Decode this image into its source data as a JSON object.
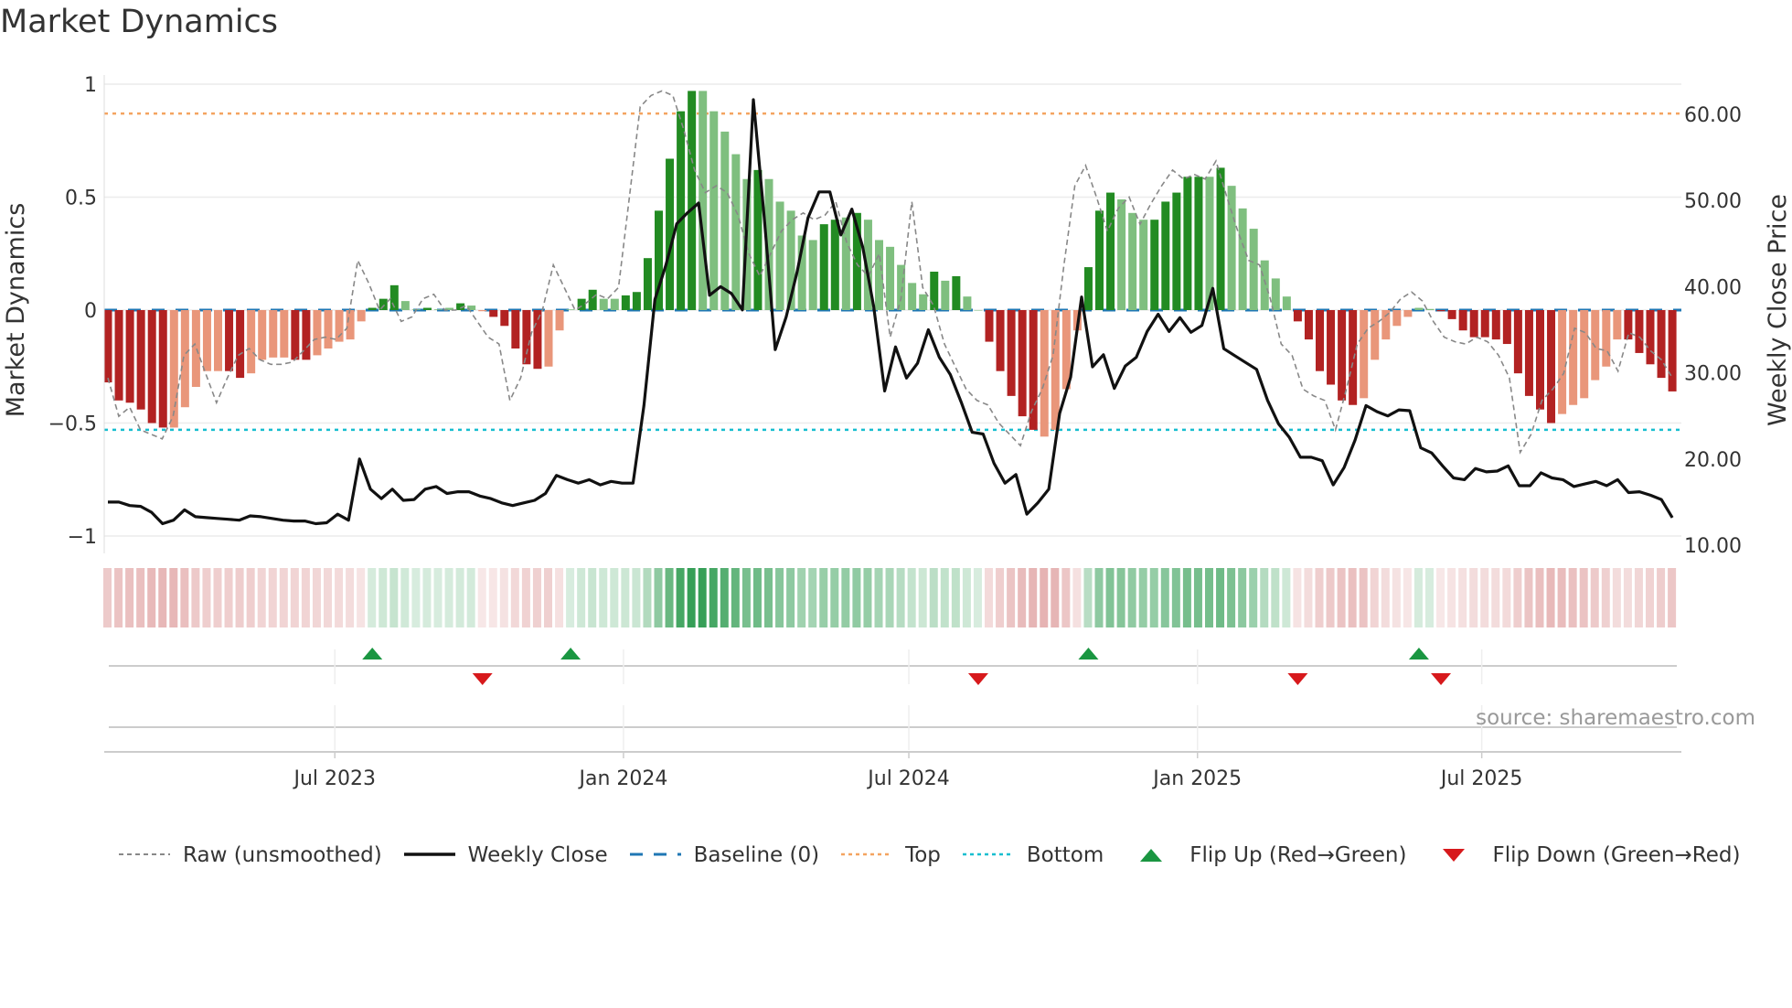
{
  "chart_data": {
    "type": "bar",
    "title": "Market Dynamics",
    "ylabel": "Market Dynamics",
    "y2label": "Weekly Close Price",
    "ylim": [
      -1.08,
      1.04
    ],
    "y2lim": [
      8.9,
      63.4
    ],
    "yticks": [
      {
        "v": 1,
        "label": "1"
      },
      {
        "v": 0.5,
        "label": "0.5"
      },
      {
        "v": 0,
        "label": "0"
      },
      {
        "v": -0.5,
        "label": "−0.5"
      },
      {
        "v": -1,
        "label": "−1"
      }
    ],
    "y2ticks": [
      {
        "v": 60,
        "label": "60.00"
      },
      {
        "v": 50,
        "label": "50.00"
      },
      {
        "v": 40,
        "label": "40.00"
      },
      {
        "v": 30,
        "label": "30.00"
      },
      {
        "v": 20,
        "label": "20.00"
      },
      {
        "v": 10,
        "label": "10.00"
      }
    ],
    "xticks": [
      {
        "week": 20.6,
        "label": "Jul 2023"
      },
      {
        "week": 46.8,
        "label": "Jan 2024"
      },
      {
        "week": 72.7,
        "label": "Jul 2024"
      },
      {
        "week": 98.9,
        "label": "Jan 2025"
      },
      {
        "week": 124.7,
        "label": "Jul 2025"
      }
    ],
    "top_level": 0.87,
    "bottom_level": -0.53,
    "baseline": 0,
    "dynamics": [
      -0.32,
      -0.4,
      -0.41,
      -0.44,
      -0.5,
      -0.52,
      -0.52,
      -0.43,
      -0.34,
      -0.27,
      -0.27,
      -0.27,
      -0.3,
      -0.28,
      -0.22,
      -0.21,
      -0.21,
      -0.22,
      -0.22,
      -0.2,
      -0.17,
      -0.14,
      -0.13,
      -0.05,
      0.01,
      0.05,
      0.11,
      0.04,
      0.003,
      0.01,
      0.003,
      0.01,
      0.03,
      0.02,
      -0.005,
      -0.03,
      -0.07,
      -0.17,
      -0.24,
      -0.26,
      -0.25,
      -0.09,
      0.003,
      0.05,
      0.09,
      0.05,
      0.05,
      0.065,
      0.08,
      0.23,
      0.44,
      0.67,
      0.88,
      0.97,
      0.97,
      0.88,
      0.79,
      0.69,
      0.58,
      0.62,
      0.58,
      0.48,
      0.44,
      0.33,
      0.31,
      0.38,
      0.4,
      0.41,
      0.43,
      0.4,
      0.31,
      0.28,
      0.2,
      0.12,
      0.07,
      0.17,
      0.13,
      0.15,
      0.06,
      0.0,
      -0.14,
      -0.27,
      -0.38,
      -0.47,
      -0.53,
      -0.56,
      -0.53,
      -0.35,
      -0.09,
      0.19,
      0.44,
      0.52,
      0.49,
      0.43,
      0.4,
      0.4,
      0.48,
      0.52,
      0.59,
      0.59,
      0.59,
      0.63,
      0.55,
      0.45,
      0.36,
      0.22,
      0.14,
      0.06,
      -0.05,
      -0.13,
      -0.27,
      -0.33,
      -0.4,
      -0.42,
      -0.39,
      -0.22,
      -0.13,
      -0.07,
      -0.03,
      0.01,
      0.005,
      -0.005,
      -0.04,
      -0.09,
      -0.12,
      -0.12,
      -0.13,
      -0.15,
      -0.28,
      -0.38,
      -0.44,
      -0.5,
      -0.46,
      -0.42,
      -0.39,
      -0.31,
      -0.25,
      -0.13,
      -0.13,
      -0.19,
      -0.24,
      -0.3,
      -0.36
    ],
    "strong": [
      1,
      1,
      1,
      1,
      1,
      1,
      0,
      0,
      0,
      0,
      0,
      1,
      1,
      0,
      0,
      0,
      0,
      1,
      1,
      0,
      0,
      0,
      0,
      0,
      1,
      1,
      1,
      0,
      0,
      1,
      0,
      0,
      1,
      0,
      0,
      1,
      1,
      1,
      1,
      1,
      0,
      0,
      0,
      1,
      1,
      0,
      0,
      1,
      1,
      1,
      1,
      1,
      1,
      1,
      0,
      0,
      0,
      0,
      0,
      1,
      0,
      0,
      0,
      0,
      0,
      1,
      1,
      0,
      1,
      0,
      0,
      0,
      0,
      0,
      0,
      1,
      0,
      1,
      0,
      0,
      1,
      1,
      1,
      1,
      1,
      0,
      0,
      0,
      0,
      1,
      1,
      1,
      0,
      0,
      0,
      1,
      1,
      1,
      1,
      1,
      0,
      1,
      0,
      0,
      0,
      0,
      0,
      0,
      1,
      1,
      1,
      1,
      1,
      1,
      0,
      0,
      0,
      0,
      0,
      0,
      0,
      1,
      1,
      1,
      1,
      1,
      1,
      1,
      1,
      1,
      1,
      1,
      0,
      0,
      0,
      0,
      0,
      0,
      1,
      1,
      1,
      1,
      1
    ],
    "raw": [
      -0.3,
      -0.47,
      -0.43,
      -0.53,
      -0.55,
      -0.57,
      -0.47,
      -0.2,
      -0.15,
      -0.28,
      -0.41,
      -0.3,
      -0.2,
      -0.17,
      -0.22,
      -0.24,
      -0.24,
      -0.23,
      -0.18,
      -0.13,
      -0.12,
      -0.13,
      -0.08,
      0.22,
      0.12,
      0.0,
      0.05,
      -0.05,
      -0.03,
      0.05,
      0.07,
      0.0,
      0.0,
      0.02,
      -0.05,
      -0.12,
      -0.15,
      -0.4,
      -0.3,
      -0.1,
      0.0,
      0.2,
      0.1,
      0.0,
      0.03,
      0.07,
      0.05,
      0.1,
      0.5,
      0.9,
      0.95,
      0.97,
      0.95,
      0.8,
      0.62,
      0.52,
      0.55,
      0.52,
      0.42,
      0.25,
      0.15,
      0.25,
      0.35,
      0.4,
      0.43,
      0.4,
      0.42,
      0.48,
      0.3,
      0.2,
      0.15,
      0.25,
      -0.12,
      0.05,
      0.48,
      0.1,
      0.02,
      -0.15,
      -0.25,
      -0.35,
      -0.4,
      -0.42,
      -0.5,
      -0.55,
      -0.6,
      -0.45,
      -0.35,
      -0.2,
      0.2,
      0.55,
      0.64,
      0.5,
      0.35,
      0.45,
      0.5,
      0.38,
      0.47,
      0.55,
      0.62,
      0.58,
      0.6,
      0.58,
      0.66,
      0.5,
      0.35,
      0.22,
      0.2,
      0.05,
      -0.15,
      -0.2,
      -0.35,
      -0.38,
      -0.4,
      -0.53,
      -0.35,
      -0.15,
      -0.08,
      -0.05,
      -0.01,
      0.05,
      0.08,
      0.04,
      -0.05,
      -0.12,
      -0.14,
      -0.15,
      -0.12,
      -0.14,
      -0.2,
      -0.3,
      -0.63,
      -0.55,
      -0.4,
      -0.35,
      -0.28,
      -0.08,
      -0.1,
      -0.17,
      -0.18,
      -0.27,
      -0.1,
      -0.12,
      -0.18,
      -0.22,
      -0.3
    ],
    "weekly_close": [
      15.0,
      15.0,
      14.6,
      14.5,
      13.8,
      12.5,
      12.9,
      14.1,
      13.3,
      13.2,
      13.1,
      13.0,
      12.9,
      13.4,
      13.3,
      13.1,
      12.9,
      12.8,
      12.8,
      12.5,
      12.6,
      13.6,
      12.9,
      20.0,
      16.5,
      15.4,
      16.5,
      15.2,
      15.3,
      16.5,
      16.8,
      16.0,
      16.2,
      16.2,
      15.7,
      15.4,
      14.9,
      14.6,
      14.9,
      15.2,
      16.0,
      18.1,
      17.6,
      17.2,
      17.6,
      17.0,
      17.4,
      17.2,
      17.2,
      26.2,
      38.5,
      42.5,
      47.3,
      48.6,
      49.7,
      39.0,
      40.0,
      39.2,
      37.3,
      61.7,
      48.0,
      32.7,
      36.5,
      41.7,
      48.0,
      51.0,
      51.0,
      46.0,
      49.0,
      44.6,
      37.7,
      27.9,
      33.0,
      29.4,
      31.1,
      35.0,
      31.8,
      29.8,
      26.6,
      23.1,
      22.9,
      19.5,
      17.2,
      18.2,
      13.6,
      14.9,
      16.5,
      25.3,
      29.5,
      38.8,
      30.7,
      32.1,
      28.2,
      30.8,
      31.8,
      34.8,
      36.8,
      34.8,
      36.4,
      34.7,
      35.5,
      39.8,
      32.8,
      32.0,
      31.2,
      30.4,
      26.8,
      24.1,
      22.5,
      20.2,
      20.2,
      19.8,
      17.0,
      19.0,
      22.2,
      26.2,
      25.5,
      25.0,
      25.7,
      25.6,
      21.3,
      20.7,
      19.2,
      17.8,
      17.6,
      18.9,
      18.5,
      18.6,
      19.2,
      16.9,
      16.9,
      18.4,
      17.8,
      17.6,
      16.8,
      17.1,
      17.4,
      16.9,
      17.6,
      16.1,
      16.2,
      15.8,
      15.3,
      13.2
    ],
    "flip_up_weeks": [
      24,
      42,
      89,
      119
    ],
    "flip_down_weeks": [
      34,
      79,
      108,
      121
    ],
    "colors": {
      "strong_up": "#228b22",
      "weak_up": "#7fbf7f",
      "strong_down": "#b22222",
      "weak_down": "#e9967a",
      "raw": "#888888",
      "close": "#111111",
      "baseline": "#1f77b4",
      "top": "#f4a460",
      "bottom": "#17becf",
      "flip_up": "#1a9641",
      "flip_down": "#d7191c"
    },
    "legend": [
      {
        "key": "raw",
        "label": "Raw (unsmoothed)"
      },
      {
        "key": "close",
        "label": "Weekly Close"
      },
      {
        "key": "baseline",
        "label": "Baseline (0)"
      },
      {
        "key": "top",
        "label": "Top"
      },
      {
        "key": "bottom",
        "label": "Bottom"
      },
      {
        "key": "flip_up",
        "label": "Flip Up (Red→Green)"
      },
      {
        "key": "flip_down",
        "label": "Flip Down (Green→Red)"
      }
    ],
    "source": "source: sharemaestro.com"
  }
}
